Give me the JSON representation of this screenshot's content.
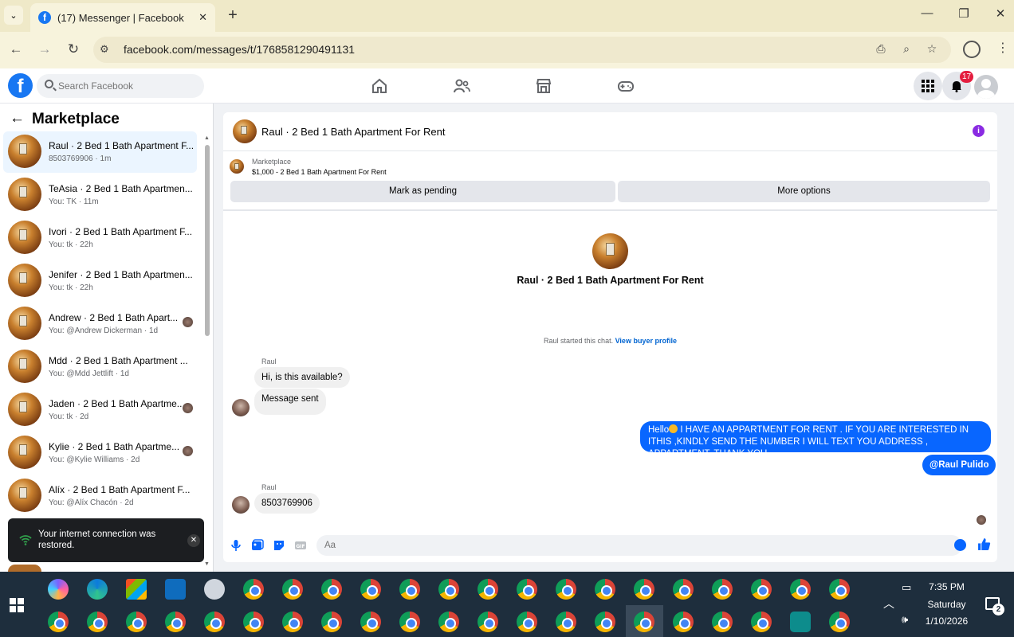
{
  "browser": {
    "tab_title": "(17) Messenger | Facebook",
    "url": "facebook.com/messages/t/1768581290491131"
  },
  "fb": {
    "search_placeholder": "Search Facebook",
    "notification_count": "17",
    "brand_color": "#1877f2"
  },
  "sidebar": {
    "title": "Marketplace",
    "conversations": [
      {
        "name": "Raul · 2 Bed 1 Bath Apartment F...",
        "meta": "8503769906 · 1m",
        "active": true
      },
      {
        "name": "TeAsia · 2 Bed 1 Bath Apartmen...",
        "meta": "You: TK · 11m"
      },
      {
        "name": "Ivori · 2 Bed 1 Bath Apartment F...",
        "meta": "You: tk · 22h"
      },
      {
        "name": "Jenifer · 2 Bed 1 Bath Apartmen...",
        "meta": "You: tk · 22h"
      },
      {
        "name": "Andrew · 2 Bed 1 Bath Apart...",
        "meta": "You: @Andrew Dickerman · 1d"
      },
      {
        "name": "Mdd · 2 Bed 1 Bath Apartment ...",
        "meta": "You: @Mdd Jettlift · 1d"
      },
      {
        "name": "Jaden · 2 Bed 1 Bath Apartme...",
        "meta": "You: tk · 2d"
      },
      {
        "name": "Kylie · 2 Bed 1 Bath Apartme...",
        "meta": "You: @Kylie Williams · 2d"
      },
      {
        "name": "Alíx · 2 Bed 1 Bath Apartment F...",
        "meta": "You: @Alíx Chacón · 2d"
      }
    ],
    "toast": "Your internet connection was restored."
  },
  "chat": {
    "header_title": "Raul · 2 Bed 1 Bath Apartment For Rent",
    "listing_label": "Marketplace",
    "listing_price": "$1,000 - 2 Bed 1 Bath Apartment For Rent",
    "mark_pending": "Mark as pending",
    "more_options": "More options",
    "big_title": "Raul · 2 Bed 1 Bath Apartment For Rent",
    "started_text": "Raul started this chat.",
    "view_profile": "View buyer profile",
    "sender_name": "Raul",
    "msg1": "Hi, is this available?",
    "msg2": "Message sent",
    "outgoing_prefix": "Hello",
    "outgoing_body": " I HAVE AN APPARTMENT  FOR RENT . IF YOU ARE INTERESTED IN ITHIS ,KINDLY SEND THE NUMBER I WILL TEXT YOU ADDRESS , APPARTMENT. THANK YOU",
    "mention": "@Raul Pulido",
    "msg3": "8503769906",
    "composer_placeholder": "Aa",
    "accent_color": "#0866ff"
  },
  "taskbar": {
    "time": "7:35 PM",
    "day": "Saturday",
    "date": "1/10/2026",
    "notification_count": "2"
  }
}
